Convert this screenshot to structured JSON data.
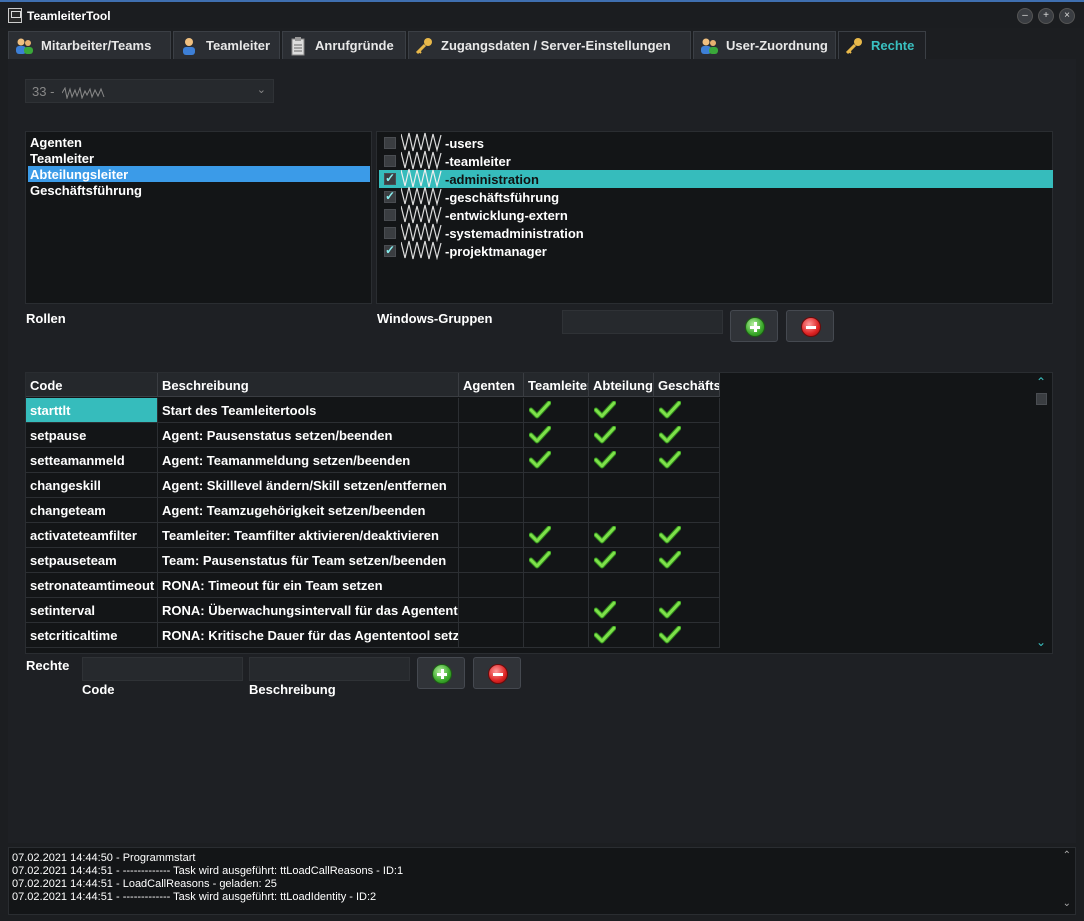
{
  "window": {
    "title": "TeamleiterTool"
  },
  "tabs": [
    {
      "label": "Mitarbeiter/Teams",
      "icon": "users-icon"
    },
    {
      "label": "Teamleiter",
      "icon": "user-icon"
    },
    {
      "label": "Anrufgründe",
      "icon": "clipboard-icon"
    },
    {
      "label": "Zugangsdaten / Server-Einstellungen",
      "icon": "key-icon"
    },
    {
      "label": "User-Zuordnung",
      "icon": "users-icon"
    },
    {
      "label": "Rechte",
      "icon": "key-icon"
    }
  ],
  "active_tab": "Rechte",
  "selector": {
    "value": "33 -"
  },
  "roles": {
    "label": "Rollen",
    "items": [
      "Agenten",
      "Teamleiter",
      "Abteilungsleiter",
      "Geschäftsführung"
    ],
    "selected": "Abteilungsleiter"
  },
  "groups": {
    "label": "Windows-Gruppen",
    "items": [
      {
        "name": "-users",
        "checked": false
      },
      {
        "name": "-teamleiter",
        "checked": false
      },
      {
        "name": "-administration",
        "checked": true
      },
      {
        "name": "-geschäftsführung",
        "checked": true
      },
      {
        "name": "-entwicklung-extern",
        "checked": false
      },
      {
        "name": "-systemadministration",
        "checked": false
      },
      {
        "name": "-projektmanager",
        "checked": true
      }
    ],
    "selected": "-administration"
  },
  "rights_table": {
    "columns": [
      "Code",
      "Beschreibung",
      "Agenten",
      "Teamleiter",
      "Abteilungsleiter",
      "Geschäftsführung"
    ],
    "rows": [
      {
        "code": "starttlt",
        "desc": "Start des Teamleitertools",
        "checks": [
          false,
          true,
          true,
          true
        ]
      },
      {
        "code": "setpause",
        "desc": "Agent: Pausenstatus setzen/beenden",
        "checks": [
          false,
          true,
          true,
          true
        ]
      },
      {
        "code": "setteamanmeld",
        "desc": "Agent: Teamanmeldung setzen/beenden",
        "checks": [
          false,
          true,
          true,
          true
        ]
      },
      {
        "code": "changeskill",
        "desc": "Agent: Skilllevel ändern/Skill setzen/entfernen",
        "checks": [
          false,
          false,
          false,
          false
        ]
      },
      {
        "code": "changeteam",
        "desc": "Agent: Teamzugehörigkeit setzen/beenden",
        "checks": [
          false,
          false,
          false,
          false
        ]
      },
      {
        "code": "activateteamfilter",
        "desc": "Teamleiter: Teamfilter aktivieren/deaktivieren",
        "checks": [
          false,
          true,
          true,
          true
        ]
      },
      {
        "code": "setpauseteam",
        "desc": "Team: Pausenstatus für Team setzen/beenden",
        "checks": [
          false,
          true,
          true,
          true
        ]
      },
      {
        "code": "setronateamtimeout",
        "desc": "RONA: Timeout für ein Team setzen",
        "checks": [
          false,
          false,
          false,
          false
        ]
      },
      {
        "code": "setinterval",
        "desc": "RONA: Überwachungsintervall für das Agententool",
        "checks": [
          false,
          false,
          true,
          true
        ]
      },
      {
        "code": "setcriticaltime",
        "desc": "RONA: Kritische Dauer für das Agententool setzen",
        "checks": [
          false,
          false,
          true,
          true
        ]
      }
    ],
    "selected_row": 0
  },
  "rights_form": {
    "label": "Rechte",
    "code_label": "Code",
    "desc_label": "Beschreibung"
  },
  "log": [
    "07.02.2021 14:44:50 - Programmstart",
    "07.02.2021 14:44:51 - ------------- Task wird ausgeführt: ttLoadCallReasons - ID:1",
    "07.02.2021 14:44:51 - LoadCallReasons - geladen: 25",
    "07.02.2021 14:44:51 - ------------- Task wird ausgeführt: ttLoadIdentity - ID:2"
  ],
  "colors": {
    "accent": "#36bcbc",
    "selection_blue": "#3b9be8",
    "background": "#1e2024"
  }
}
